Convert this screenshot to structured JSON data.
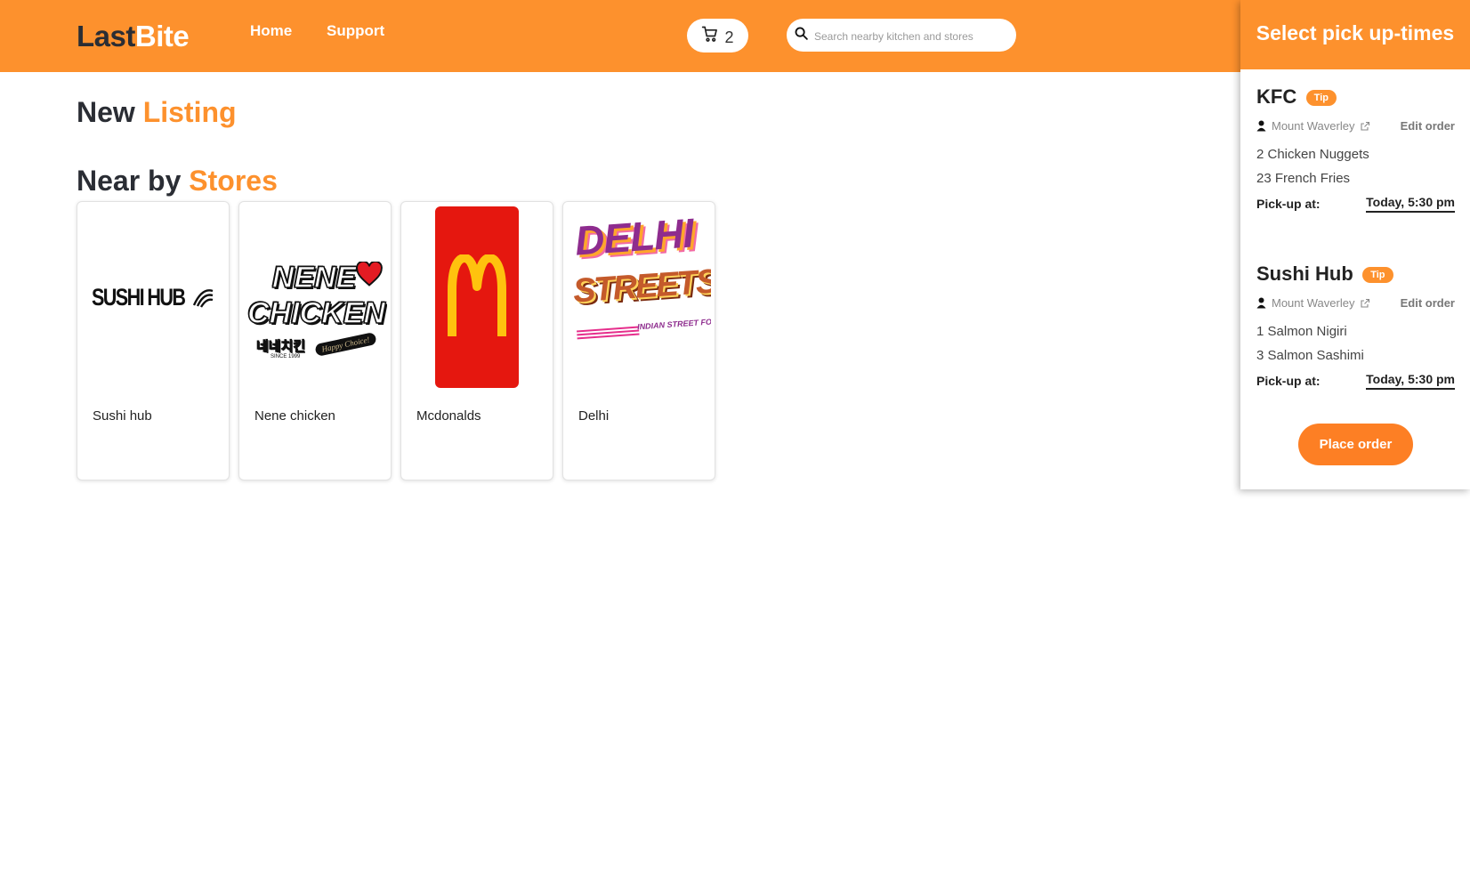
{
  "header": {
    "logo_part1": "Last",
    "logo_part2": "Bite",
    "nav": [
      {
        "label": "Home"
      },
      {
        "label": "Support"
      }
    ],
    "cart_count": "2",
    "search_placeholder": "Search nearby kitchen and stores"
  },
  "main": {
    "new_listing": {
      "part1": "New",
      "part2": "Listing"
    },
    "nearby": {
      "part1": "Near by",
      "part2": "Stores"
    },
    "stores": [
      {
        "name": "Sushi hub",
        "logo_text": "SUSHI HUB"
      },
      {
        "name": "Nene chicken",
        "logo_text": "NENE CHICKEN",
        "logo_subtext": "네네치킨",
        "logo_since": "SINCE 1999",
        "logo_ribbon": "Happy Choice!"
      },
      {
        "name": "Mcdonalds",
        "logo_text": "M"
      },
      {
        "name": "Delhi",
        "logo_text_1": "DELHI",
        "logo_text_2": "STREETS",
        "logo_subtext": "INDIAN STREET FOOD"
      }
    ]
  },
  "panel": {
    "title": "Select pick up-times",
    "tip_label": "Tip",
    "edit_label": "Edit order",
    "pickup_label": "Pick-up at:",
    "orders": [
      {
        "name": "KFC",
        "location": "Mount Waverley",
        "items": [
          "2 Chicken Nuggets",
          "23 French Fries"
        ],
        "pickup_time": "Today, 5:30 pm"
      },
      {
        "name": "Sushi Hub",
        "location": "Mount Waverley",
        "items": [
          "1 Salmon Nigiri",
          "3 Salmon Sashimi"
        ],
        "pickup_time": "Today, 5:30 pm"
      }
    ],
    "place_order_label": "Place order"
  },
  "colors": {
    "brand_orange": "#fd912d",
    "button_orange": "#fd7f24",
    "dark_text": "#2a2d34",
    "mcd_red": "#e5170f",
    "mcd_yellow": "#ffc20e"
  }
}
